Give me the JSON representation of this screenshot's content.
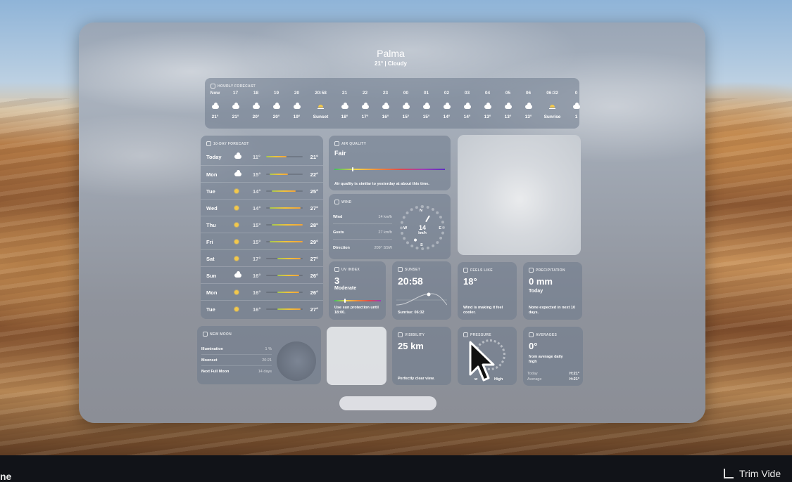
{
  "app": {
    "city": "Palma",
    "temp_condition": "21° | Cloudy"
  },
  "hourly": {
    "title": "HOURLY FORECAST",
    "hours": [
      {
        "time": "Now",
        "icon": "cloud-icon",
        "temp": "21°"
      },
      {
        "time": "17",
        "icon": "cloud-icon",
        "temp": "21°"
      },
      {
        "time": "18",
        "icon": "cloud-icon",
        "temp": "20°"
      },
      {
        "time": "19",
        "icon": "cloud-icon",
        "temp": "20°"
      },
      {
        "time": "20",
        "icon": "cloud-icon",
        "temp": "19°"
      },
      {
        "time": "20:58",
        "icon": "sunset-icon",
        "temp": "Sunset"
      },
      {
        "time": "21",
        "icon": "cloud-icon",
        "temp": "18°"
      },
      {
        "time": "22",
        "icon": "partly-cloudy-icon",
        "temp": "17°"
      },
      {
        "time": "23",
        "icon": "partly-cloudy-icon",
        "temp": "16°"
      },
      {
        "time": "00",
        "icon": "cloud-icon",
        "temp": "15°"
      },
      {
        "time": "01",
        "icon": "cloud-icon",
        "temp": "15°"
      },
      {
        "time": "02",
        "icon": "cloud-icon",
        "temp": "14°"
      },
      {
        "time": "03",
        "icon": "cloud-icon",
        "temp": "14°"
      },
      {
        "time": "04",
        "icon": "cloud-icon",
        "temp": "13°"
      },
      {
        "time": "05",
        "icon": "cloud-icon",
        "temp": "13°"
      },
      {
        "time": "06",
        "icon": "partly-cloudy-icon",
        "temp": "13°"
      },
      {
        "time": "06:32",
        "icon": "sunrise-icon",
        "temp": "Sunrise"
      },
      {
        "time": "0",
        "icon": "cloud-icon",
        "temp": "1"
      }
    ]
  },
  "tenday": {
    "title": "10-DAY FORECAST",
    "days": [
      {
        "day": "Today",
        "icon": "cloud-icon",
        "lo": "11°",
        "hi": "21°",
        "lo_frac": 0.0,
        "hi_frac": 0.55
      },
      {
        "day": "Mon",
        "icon": "partly-cloudy-icon",
        "lo": "15°",
        "hi": "22°",
        "lo_frac": 0.1,
        "hi_frac": 0.6
      },
      {
        "day": "Tue",
        "icon": "sun-icon",
        "lo": "14°",
        "hi": "25°",
        "lo_frac": 0.15,
        "hi_frac": 0.8
      },
      {
        "day": "Wed",
        "icon": "sun-icon",
        "lo": "14°",
        "hi": "27°",
        "lo_frac": 0.1,
        "hi_frac": 0.95
      },
      {
        "day": "Thu",
        "icon": "sun-icon",
        "lo": "15°",
        "hi": "28°",
        "lo_frac": 0.15,
        "hi_frac": 1.0
      },
      {
        "day": "Fri",
        "icon": "sun-icon",
        "lo": "15°",
        "hi": "29°",
        "lo_frac": 0.1,
        "hi_frac": 1.0
      },
      {
        "day": "Sat",
        "icon": "sun-icon",
        "lo": "17°",
        "hi": "27°",
        "lo_frac": 0.3,
        "hi_frac": 0.95
      },
      {
        "day": "Sun",
        "icon": "partly-cloudy-icon",
        "lo": "16°",
        "hi": "26°",
        "lo_frac": 0.3,
        "hi_frac": 0.9
      },
      {
        "day": "Mon",
        "icon": "sun-icon",
        "lo": "16°",
        "hi": "26°",
        "lo_frac": 0.3,
        "hi_frac": 0.9
      },
      {
        "day": "Tue",
        "icon": "sun-icon",
        "lo": "16°",
        "hi": "27°",
        "lo_frac": 0.3,
        "hi_frac": 0.95
      }
    ]
  },
  "air_quality": {
    "title": "AIR QUALITY",
    "value": "Fair",
    "description": "Air quality is similar to yesterday at about this time."
  },
  "wind": {
    "title": "WIND",
    "rows": [
      {
        "label": "Wind",
        "value": "14 km/h"
      },
      {
        "label": "Gusts",
        "value": "27 km/h"
      },
      {
        "label": "Direction",
        "value": "209° SSW"
      }
    ],
    "speed": "14",
    "unit": "km/h",
    "n": "N",
    "s": "S",
    "e": "E",
    "w": "W"
  },
  "uv": {
    "title": "UV INDEX",
    "value": "3",
    "level": "Moderate",
    "note": "Use sun protection until 18:00."
  },
  "sunset": {
    "title": "SUNSET",
    "time": "20:58",
    "sunrise": "Sunrise: 06:32"
  },
  "feels_like": {
    "title": "FEELS LIKE",
    "value": "18°",
    "note": "Wind is making it feel cooler."
  },
  "precipitation": {
    "title": "PRECIPITATION",
    "value": "0 mm",
    "period": "Today",
    "note": "None expected in next 10 days."
  },
  "moon": {
    "title": "NEW MOON",
    "rows": [
      {
        "label": "Illumination",
        "value": "1 %"
      },
      {
        "label": "Moonset",
        "value": "20:21"
      },
      {
        "label": "Next Full Moon",
        "value": "14 days"
      }
    ]
  },
  "visibility": {
    "title": "VISIBILITY",
    "value": "25 km",
    "note": "Perfectly clear view."
  },
  "pressure": {
    "title": "PRESSURE",
    "low": "w",
    "high": "High"
  },
  "averages": {
    "title": "AVERAGES",
    "value": "0°",
    "note": "from average daily high",
    "rows": [
      {
        "label": "Today",
        "value": "H:21°"
      },
      {
        "label": "Average",
        "value": "H:21°"
      }
    ]
  },
  "bottom": {
    "left_label": "ne",
    "trim_label": "Trim Vide"
  }
}
